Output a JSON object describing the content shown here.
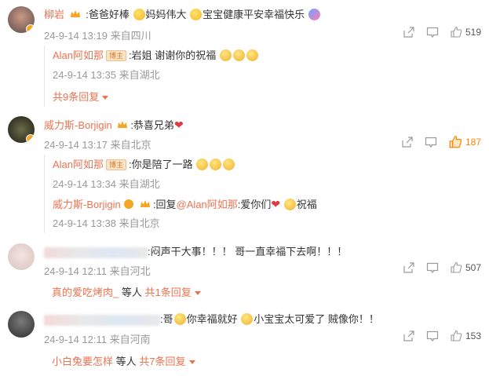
{
  "comments": [
    {
      "user": "柳岩",
      "sep": ":",
      "text_parts": [
        "爸爸好棒",
        "妈妈伟大",
        "宝宝健康平安幸福快乐"
      ],
      "time": "24-9-14 13:19",
      "location": "来自四川",
      "likes": "519",
      "replies": [
        {
          "user": "Alan阿如那",
          "badge": "博主",
          "text": ":岩姐 谢谢你的祝福",
          "time": "24-9-14 13:35",
          "location": "来自湖北"
        }
      ],
      "more": "共9条回复"
    },
    {
      "user": "威力斯-Borjigin",
      "text": ":恭喜兄弟",
      "time": "24-9-14 13:17",
      "location": "来自北京",
      "likes": "187",
      "replies": [
        {
          "user": "Alan阿如那",
          "badge": "博主",
          "text": ":你是陪了一路",
          "time": "24-9-14 13:34",
          "location": "来自湖北"
        },
        {
          "user": "威力斯-Borjigin",
          "prefix": ":回复",
          "mention": "@Alan阿如那",
          "text": ":爱你们",
          "text2": "祝福",
          "time": "24-9-14 13:38",
          "location": "来自北京"
        }
      ]
    },
    {
      "text": ":闷声干大事！！！ 哥一直幸福下去啊！！！",
      "time": "24-9-14 12:11",
      "location": "来自河北",
      "likes": "507",
      "reply_user": "真的爱吃烤肉_",
      "reply_suffix": "等人",
      "more": "共1条回复"
    },
    {
      "text_a": ":哥",
      "text_b": "你幸福就好",
      "text_c": "小宝宝太可爱了 贼像你！！",
      "time": "24-9-14 12:11",
      "location": "来自河南",
      "likes": "153",
      "reply_user": "小白兔要怎样",
      "reply_suffix": "等人",
      "more": "共7条回复"
    }
  ],
  "colors": {
    "accent": "#eb7350",
    "meta": "#999999",
    "hot_like": "#ff8200"
  },
  "icons": [
    "share-icon",
    "comment-icon",
    "like-icon",
    "crown-icon",
    "heart-icon",
    "emoji-icon"
  ]
}
